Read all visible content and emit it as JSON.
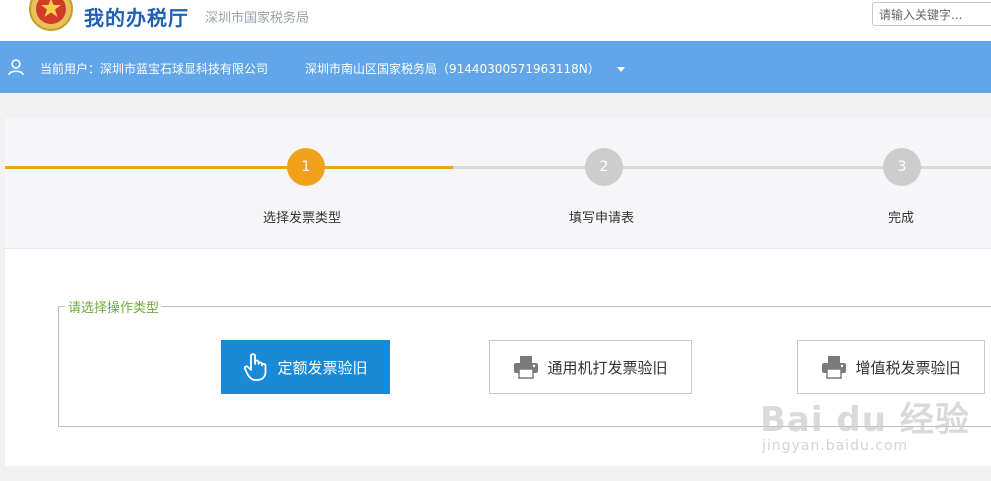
{
  "header": {
    "title": "我的办税厅",
    "subtitle": "深圳市国家税务局",
    "search_placeholder": "请输入关键字..."
  },
  "userbar": {
    "current_user": "当前用户：深圳市蓝宝石球显科技有限公司",
    "tax_office": "深圳市南山区国家税务局（91440300571963118N）"
  },
  "steps": [
    {
      "number": "1",
      "label": "选择发票类型",
      "state": "active"
    },
    {
      "number": "2",
      "label": "填写申请表",
      "state": "inactive"
    },
    {
      "number": "3",
      "label": "完成",
      "state": "inactive"
    }
  ],
  "operation": {
    "legend": "请选择操作类型",
    "buttons": [
      {
        "label": "定额发票验旧",
        "icon": "hand-pointer-icon"
      },
      {
        "label": "通用机打发票验旧",
        "icon": "printer-icon"
      },
      {
        "label": "增值税发票验旧",
        "icon": "printer-icon"
      }
    ]
  },
  "watermark": {
    "text": "Bai du 经验",
    "url": "jingyan.baidu.com"
  },
  "colors": {
    "accent_orange": "#f2a11b",
    "userbar_blue": "#62a6ea",
    "primary_button": "#1a89d6",
    "legend_green": "#6fab3a"
  }
}
